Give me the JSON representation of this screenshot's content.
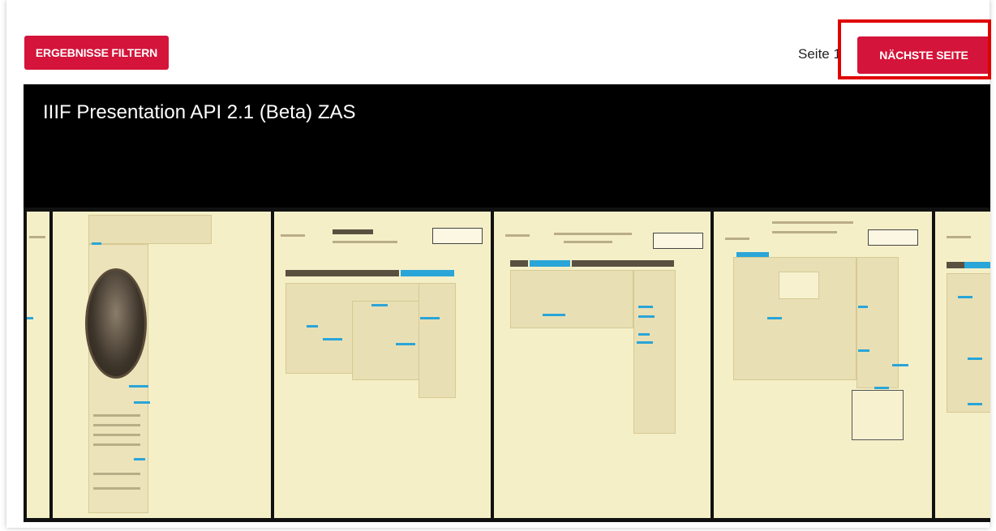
{
  "toolbar": {
    "filter_label": "ERGEBNISSE FILTERN",
    "page_label": "Seite 1",
    "next_label": "NÄCHSTE SEITE"
  },
  "viewer": {
    "title": "IIIF Presentation API 2.1 (Beta) ZAS"
  },
  "colors": {
    "accent": "#d4143a",
    "highlight": "#e00000",
    "viewer_bg": "#000000",
    "paper": "#f5efc8",
    "marker": "#2aa5d8"
  },
  "thumbnails": [
    {
      "name": "doc-portrait"
    },
    {
      "name": "doc-tages-anzeiger"
    },
    {
      "name": "doc-schaffhauser-nachrichten"
    },
    {
      "name": "doc-handelszeitung"
    },
    {
      "name": "doc-partial"
    }
  ]
}
